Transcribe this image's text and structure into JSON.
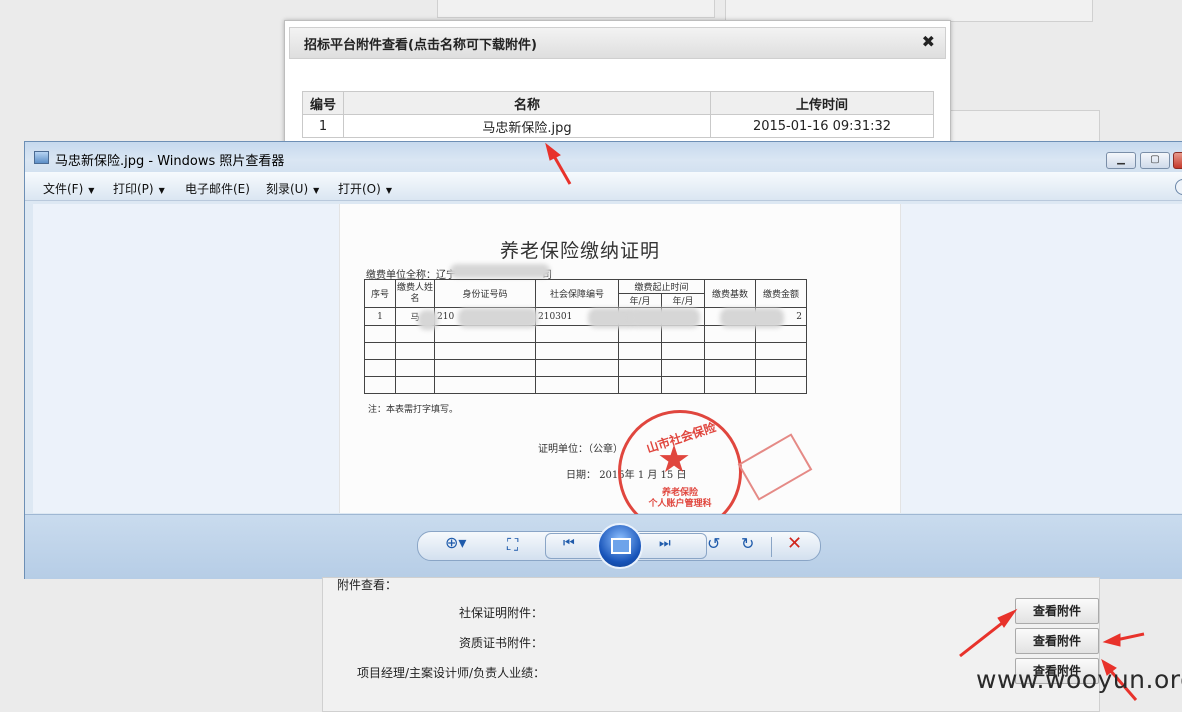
{
  "attachment_dialog": {
    "title": "招标平台附件查看(点击名称可下载附件)",
    "close_glyph": "✖",
    "columns": [
      "编号",
      "名称",
      "上传时间"
    ],
    "rows": [
      {
        "no": "1",
        "name": "马忠新保险.jpg",
        "uploaded": "2015-01-16 09:31:32"
      }
    ]
  },
  "photo_viewer": {
    "title": "马忠新保险.jpg - Windows 照片查看器",
    "menus": [
      "文件(F)",
      "打印(P)",
      "电子邮件(E)",
      "刻录(U)",
      "打开(O)"
    ],
    "document": {
      "title": "养老保险缴纳证明",
      "unit_label": "缴费单位全称：辽宁",
      "unit_suffix": "司",
      "headers": {
        "seq": "序号",
        "payer": "缴费人姓名",
        "id": "身份证号码",
        "ssn": "社会保障编号",
        "period": "缴费起止时间",
        "period_from": "年/月",
        "period_to": "年/月",
        "base": "缴费基数",
        "amount": "缴费金额"
      },
      "row1": {
        "seq": "1",
        "payer": "马",
        "id": "210",
        "ssn": "210301",
        "from": "2",
        "amount": "2"
      },
      "note": "注：本表需打字填写。",
      "cert": "证明单位：（公章）",
      "date_label": "日期：",
      "date_value": "2015年  1 月 15 日",
      "stamp_arc": "山市社会保险",
      "stamp_line1": "养老保险",
      "stamp_line2": "个人账户管理科"
    }
  },
  "form": {
    "section_label": "附件查看：",
    "rows": [
      {
        "label": "社保证明附件：",
        "button": "查看附件"
      },
      {
        "label": "资质证书附件：",
        "button": "查看附件"
      },
      {
        "label": "项目经理/主案设计师/负责人业绩：",
        "button": "查看附件"
      }
    ]
  },
  "watermark": "www.wooyun.org",
  "colors": {
    "annotation_arrow": "#e8322b",
    "viewer_accent": "#1f5bab"
  }
}
